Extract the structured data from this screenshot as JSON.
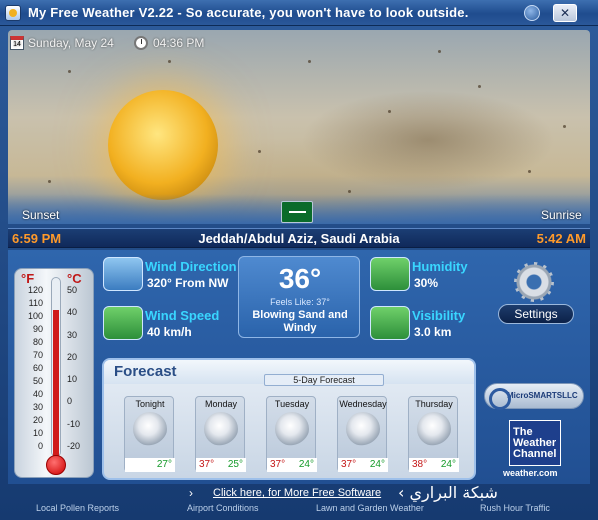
{
  "window": {
    "title": "My Free Weather V2.22 -  So accurate, you won't have to look outside.",
    "close_glyph": "✕"
  },
  "header": {
    "calendar_glyph": "14",
    "date": "Sunday, May 24",
    "time": "04:36 PM"
  },
  "sun": {
    "sunset_label": "Sunset",
    "sunrise_label": "Sunrise",
    "sunset_time": "6:59 PM",
    "sunrise_time": "5:42 AM"
  },
  "location": "Jeddah/Abdul Aziz, Saudi Arabia",
  "current": {
    "temperature": "36°",
    "feels_like": "Feels Like: 37°",
    "condition": "Blowing Sand  and Windy"
  },
  "details": {
    "wind_direction_label": "Wind Direction",
    "wind_direction_value": "320° From NW",
    "wind_speed_label": "Wind Speed",
    "wind_speed_value": "40 km/h",
    "humidity_label": "Humidity",
    "humidity_value": "30%",
    "visibility_label": "Visibility",
    "visibility_value": "3.0 km"
  },
  "settings_label": "Settings",
  "thermometer": {
    "f_label": "°F",
    "c_label": "°C",
    "f_ticks": [
      "120",
      "110",
      "100",
      "90",
      "80",
      "70",
      "60",
      "50",
      "40",
      "30",
      "20",
      "10",
      "0"
    ],
    "c_ticks": [
      "50",
      "40",
      "30",
      "20",
      "10",
      "0",
      "-10",
      "-20"
    ],
    "level_fraction": 0.83
  },
  "forecast": {
    "title": "Forecast",
    "subtitle": "5-Day Forecast",
    "days": [
      {
        "name": "Tonight",
        "high": "",
        "low": "27°"
      },
      {
        "name": "Monday",
        "high": "37°",
        "low": "25°"
      },
      {
        "name": "Tuesday",
        "high": "37°",
        "low": "24°"
      },
      {
        "name": "Wednesday",
        "high": "37°",
        "low": "24°"
      },
      {
        "name": "Thursday",
        "high": "38°",
        "low": "24°"
      }
    ]
  },
  "logos": {
    "microsmarts": "MicroSMARTSLLC",
    "twc_line1": "The",
    "twc_line2": "Weather",
    "twc_line3": "Channel",
    "twc_url": "weather.com"
  },
  "links": {
    "more_software": "Click here, for More Free Software",
    "arabic_site": "شبكة البراري",
    "footer": [
      "Local Pollen Reports",
      "Airport Conditions",
      "Lawn and Garden Weather",
      "Rush Hour Traffic"
    ]
  },
  "colors": {
    "accent_label": "#39d6ff",
    "sun_time": "#ff9a2a",
    "high_temp": "#c41818",
    "low_temp": "#159a2a"
  }
}
